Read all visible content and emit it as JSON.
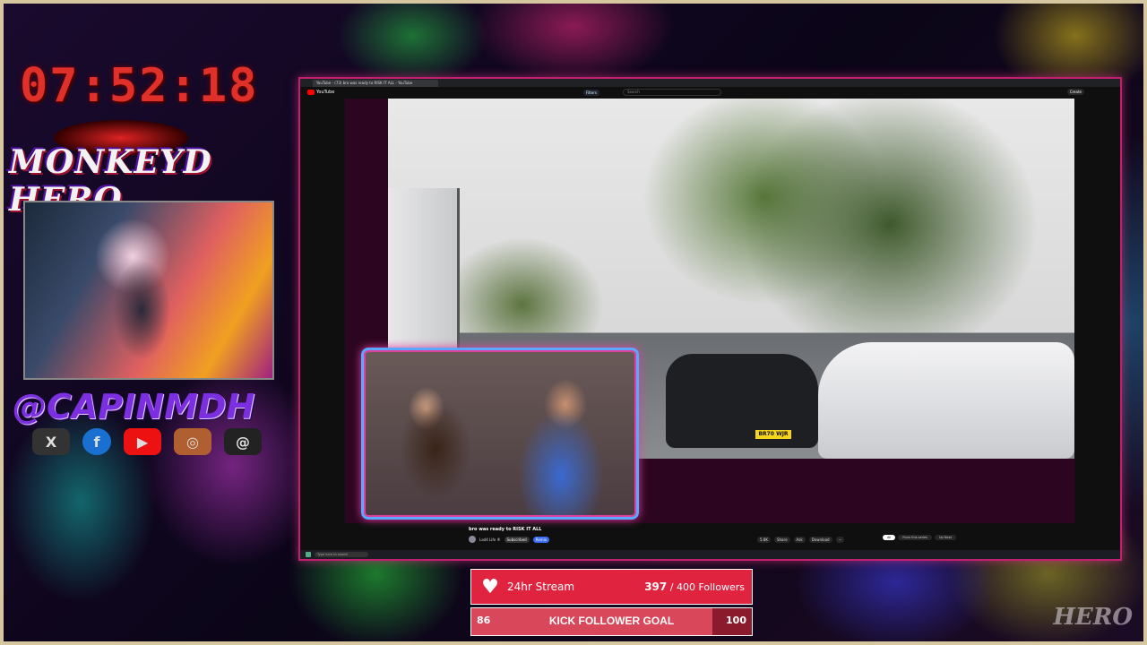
{
  "overlay": {
    "clock": "07:52:18",
    "brand": "MONKEYD HERO",
    "handle": "@CAPINMDH",
    "socials": [
      "X",
      "f",
      "▶",
      "◎",
      "@"
    ]
  },
  "browser": {
    "tab_title": "YouTube - (73) bro was ready to RISK IT ALL - YouTube",
    "site": "YouTube",
    "filter_chip": "Filters",
    "search_placeholder": "Search",
    "create_label": "Create",
    "plate": "BR70 WJR",
    "video_title": "bro was ready to RISK IT ALL",
    "channel_name": "Lad4 Life ®",
    "subscribe_label": "Subscribed",
    "join_label": "Remix",
    "actions": [
      "5.8K",
      "Share",
      "Ask",
      "Download",
      "···"
    ],
    "chips": [
      "All",
      "From this series",
      "Up Next"
    ],
    "taskbar_search": "Type here to search"
  },
  "stream": {
    "label": "24hr Stream",
    "followers_current": "397",
    "followers_suffix": "/ 400 Followers"
  },
  "goal": {
    "title": "KICK FOLLOWER GOAL",
    "start": "86",
    "end": "100",
    "progress_fraction": 0.86
  },
  "colors": {
    "stream_red": "#e0243f",
    "goal_dark": "#8a1a2c",
    "browser_border": "#c02070"
  }
}
